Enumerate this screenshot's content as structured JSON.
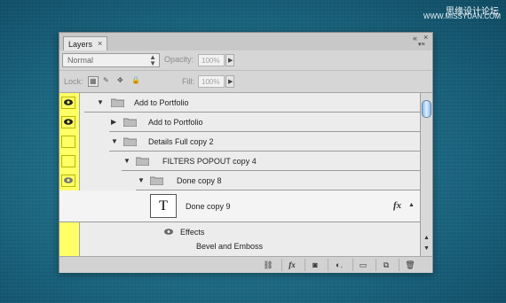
{
  "watermark": {
    "line1": "思缘设计论坛",
    "line2": "WWW.MISSYUAN.COM"
  },
  "panel": {
    "tab_label": "Layers",
    "tab_close": "×",
    "collapse_glyph": "«",
    "close_glyph": "×",
    "menu_glyph": "▾≡"
  },
  "options": {
    "blend_mode": "Normal",
    "opacity_label": "Opacity:",
    "opacity_value": "100%",
    "lock_label": "Lock:",
    "fill_label": "Fill:",
    "fill_value": "100%"
  },
  "layers": [
    {
      "name": "Add to Portfolio",
      "type": "group",
      "expanded": true,
      "visible": true,
      "depth": 0
    },
    {
      "name": "Add to Portfolio",
      "type": "group",
      "expanded": false,
      "visible": true,
      "depth": 1
    },
    {
      "name": "Details Full copy 2",
      "type": "group",
      "expanded": true,
      "visible": false,
      "depth": 1
    },
    {
      "name": "FILTERS POPOUT copy 4",
      "type": "group",
      "expanded": true,
      "visible": false,
      "depth": 2
    },
    {
      "name": "Done copy 8",
      "type": "group",
      "expanded": true,
      "visible": true,
      "depth": 3
    },
    {
      "name": "Done copy 9",
      "type": "text",
      "visible": true,
      "depth": 4,
      "thumb_glyph": "T",
      "fx_label": "fx"
    },
    {
      "name": "Effects",
      "type": "effects",
      "depth": 5
    },
    {
      "name": "Bevel and Emboss",
      "type": "effect",
      "depth": 6
    }
  ],
  "bottom_icons": [
    "link-icon",
    "fx-icon",
    "mask-icon",
    "adjustment-icon",
    "new-group-icon",
    "new-layer-icon",
    "trash-icon"
  ],
  "bottom_labels": {
    "link": "⛓",
    "fx": "fx",
    "mask": "◙",
    "adjust": "◐.",
    "group": "▭",
    "new": "⧉",
    "trash": "🗑"
  },
  "colors": {
    "visibility_column": "#ffff66",
    "panel_bg": "#d6d6d6",
    "list_bg": "#ececec"
  }
}
